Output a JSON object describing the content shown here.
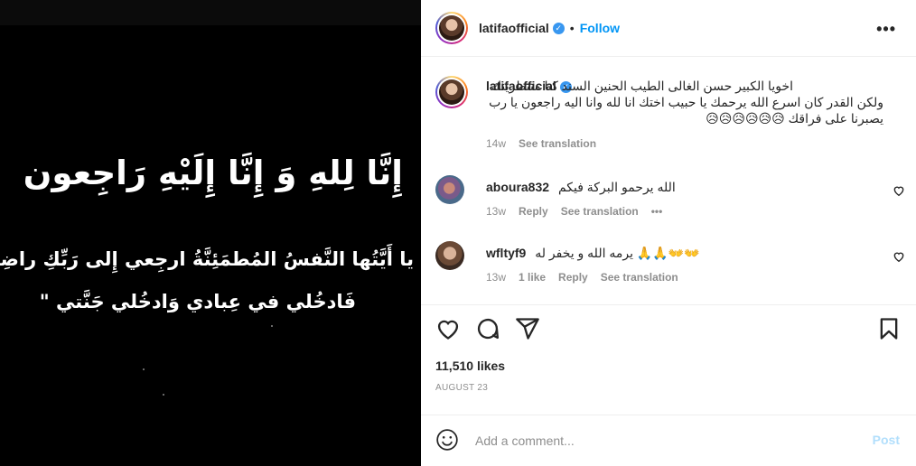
{
  "media": {
    "line1": "إِنَّا لِلهِ وَ إِنَّا إِلَيْهِ رَاجِعون",
    "line2": "يا أَيَّتُها النَّفسُ المُطمَئِنَّةُ ارجِعي إِلى رَبِّكِ راضِيَةً مَرضِيَّةً",
    "line3": "فَادخُلي في عِبادي وَادخُلي جَنَّتي \""
  },
  "header": {
    "username": "latifaofficial",
    "verified": "✓",
    "dot": "•",
    "follow": "Follow",
    "more": "•••"
  },
  "caption": {
    "username": "latifaofficial",
    "verified": "✓",
    "text": "اخويا الكبير حسن الغالى الطيب الحنين السند كنا منتظرينك ولكن القدر كان اسرع الله يرحمك يا حبيب اختك انا لله وانا اليه راجعون يا رب يصبرنا على فراقك 😥😥😥😥😥😥",
    "time": "14w",
    "see_translation": "See translation"
  },
  "comments": [
    {
      "username": "aboura832",
      "text": "الله يرحمو البركة فيكم",
      "time": "13w",
      "reply": "Reply",
      "see_translation": "See translation",
      "more": "•••"
    },
    {
      "username": "wfltyf9",
      "text": "يرمه الله و يخفر له 🙏🙏👐👐",
      "time": "13w",
      "likes": "1 like",
      "reply": "Reply",
      "see_translation": "See translation"
    }
  ],
  "footer": {
    "likes": "11,510 likes",
    "date": "AUGUST 23",
    "comment_placeholder": "Add a comment...",
    "post": "Post"
  },
  "icons": [
    "heart-icon",
    "comment-icon",
    "share-icon",
    "save-icon",
    "emoji-icon",
    "more-icon",
    "verified-icon"
  ],
  "colors": {
    "link": "#0095f6",
    "verified": "#3897f0",
    "muted": "#8e8e8e",
    "post_disabled": "#b2dffc"
  }
}
